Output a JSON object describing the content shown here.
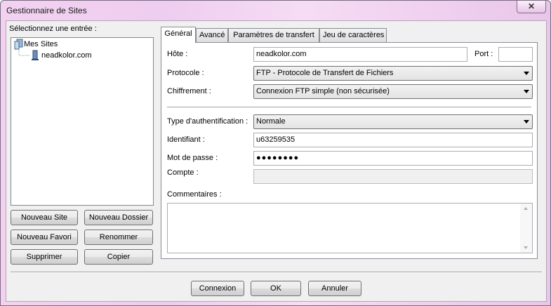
{
  "window": {
    "title": "Gestionnaire de Sites",
    "close_glyph": "✕"
  },
  "left": {
    "select_label": "Sélectionnez une entrée :",
    "tree": {
      "root": "Mes Sites",
      "child": "neadkolor.com"
    },
    "buttons": {
      "new_site": "Nouveau Site",
      "new_folder": "Nouveau Dossier",
      "new_bookmark": "Nouveau Favori",
      "rename": "Renommer",
      "delete": "Supprimer",
      "copy": "Copier"
    }
  },
  "tabs": [
    "Général",
    "Avancé",
    "Paramètres de transfert",
    "Jeu de caractères"
  ],
  "general": {
    "host_label": "Hôte :",
    "host_value": "neadkolor.com",
    "port_label": "Port :",
    "port_value": "",
    "protocol_label": "Protocole :",
    "protocol_value": "FTP - Protocole de Transfert de Fichiers",
    "encryption_label": "Chiffrement :",
    "encryption_value": "Connexion FTP simple (non sécurisée)",
    "auth_label": "Type d'authentification :",
    "auth_value": "Normale",
    "user_label": "Identifiant :",
    "user_value": "u63259535",
    "password_label": "Mot de passe :",
    "password_value": "●●●●●●●●",
    "account_label": "Compte :",
    "account_value": "",
    "comments_label": "Commentaires :"
  },
  "footer": {
    "connect": "Connexion",
    "ok": "OK",
    "cancel": "Annuler"
  }
}
